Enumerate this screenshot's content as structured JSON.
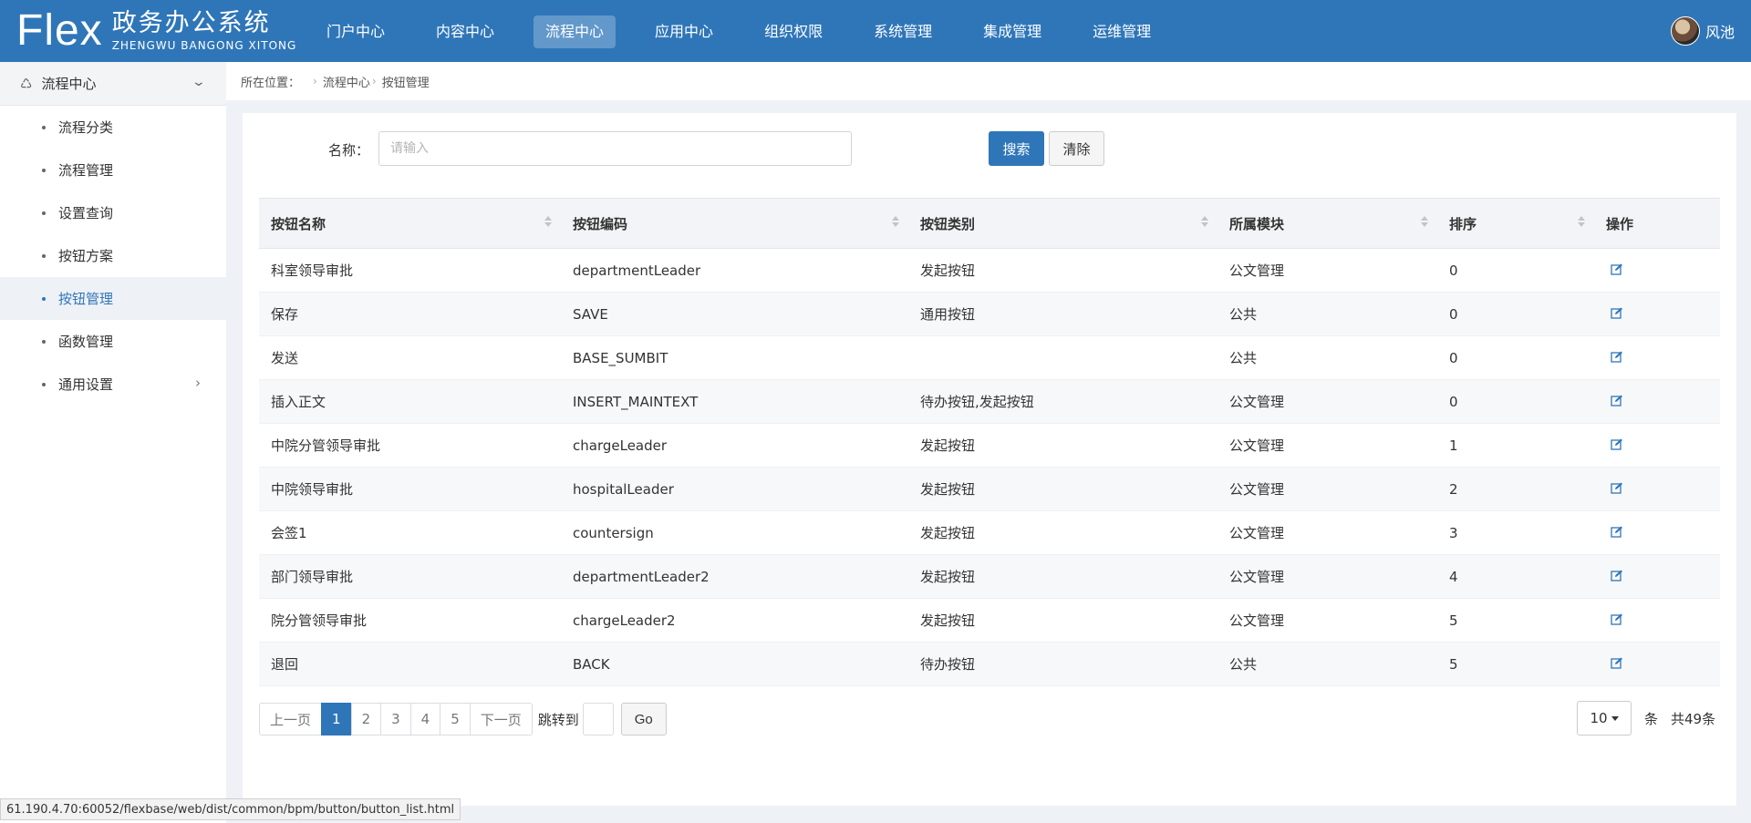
{
  "logo": {
    "flex": "Flex",
    "cn": "政务办公系统",
    "en": "ZHENGWU BANGONG XITONG"
  },
  "nav": {
    "items": [
      "门户中心",
      "内容中心",
      "流程中心",
      "应用中心",
      "组织权限",
      "系统管理",
      "集成管理",
      "运维管理"
    ],
    "active_index": 2
  },
  "user": {
    "name": "风池"
  },
  "sidebar": {
    "header": "流程中心",
    "items": [
      {
        "label": "流程分类"
      },
      {
        "label": "流程管理"
      },
      {
        "label": "设置查询"
      },
      {
        "label": "按钮方案"
      },
      {
        "label": "按钮管理",
        "active": true
      },
      {
        "label": "函数管理"
      },
      {
        "label": "通用设置",
        "has_children": true
      }
    ]
  },
  "breadcrumb": {
    "prefix": "所在位置：",
    "level1": "流程中心",
    "level2": "按钮管理"
  },
  "search": {
    "label": "名称：",
    "placeholder": "请输入",
    "value": "",
    "search_btn": "搜索",
    "clear_btn": "清除"
  },
  "table": {
    "columns": [
      "按钮名称",
      "按钮编码",
      "按钮类别",
      "所属模块",
      "排序",
      "操作"
    ],
    "rows": [
      [
        "科室领导审批",
        "departmentLeader",
        "发起按钮",
        "公文管理",
        "0"
      ],
      [
        "保存",
        "SAVE",
        "通用按钮",
        "公共",
        "0"
      ],
      [
        "发送",
        "BASE_SUMBIT",
        "",
        "公共",
        "0"
      ],
      [
        "插入正文",
        "INSERT_MAINTEXT",
        "待办按钮,发起按钮",
        "公文管理",
        "0"
      ],
      [
        "中院分管领导审批",
        "chargeLeader",
        "发起按钮",
        "公文管理",
        "1"
      ],
      [
        "中院领导审批",
        "hospitalLeader",
        "发起按钮",
        "公文管理",
        "2"
      ],
      [
        "会签1",
        "countersign",
        "发起按钮",
        "公文管理",
        "3"
      ],
      [
        "部门领导审批",
        "departmentLeader2",
        "发起按钮",
        "公文管理",
        "4"
      ],
      [
        "院分管领导审批",
        "chargeLeader2",
        "发起按钮",
        "公文管理",
        "5"
      ],
      [
        "退回",
        "BACK",
        "待办按钮",
        "公共",
        "5"
      ]
    ]
  },
  "pagination": {
    "prev": "上一页",
    "pages": [
      "1",
      "2",
      "3",
      "4",
      "5"
    ],
    "current": "1",
    "next": "下一页",
    "jump_label": "跳转到",
    "go": "Go",
    "page_size": "10",
    "size_unit": "条",
    "total": "共49条"
  },
  "status_url": "61.190.4.70:60052/flexbase/web/dist/common/bpm/button/button_list.html",
  "colors": {
    "primary": "#2f76b8",
    "topbar": "#2f76b8",
    "page_bg": "#eef1f6"
  }
}
